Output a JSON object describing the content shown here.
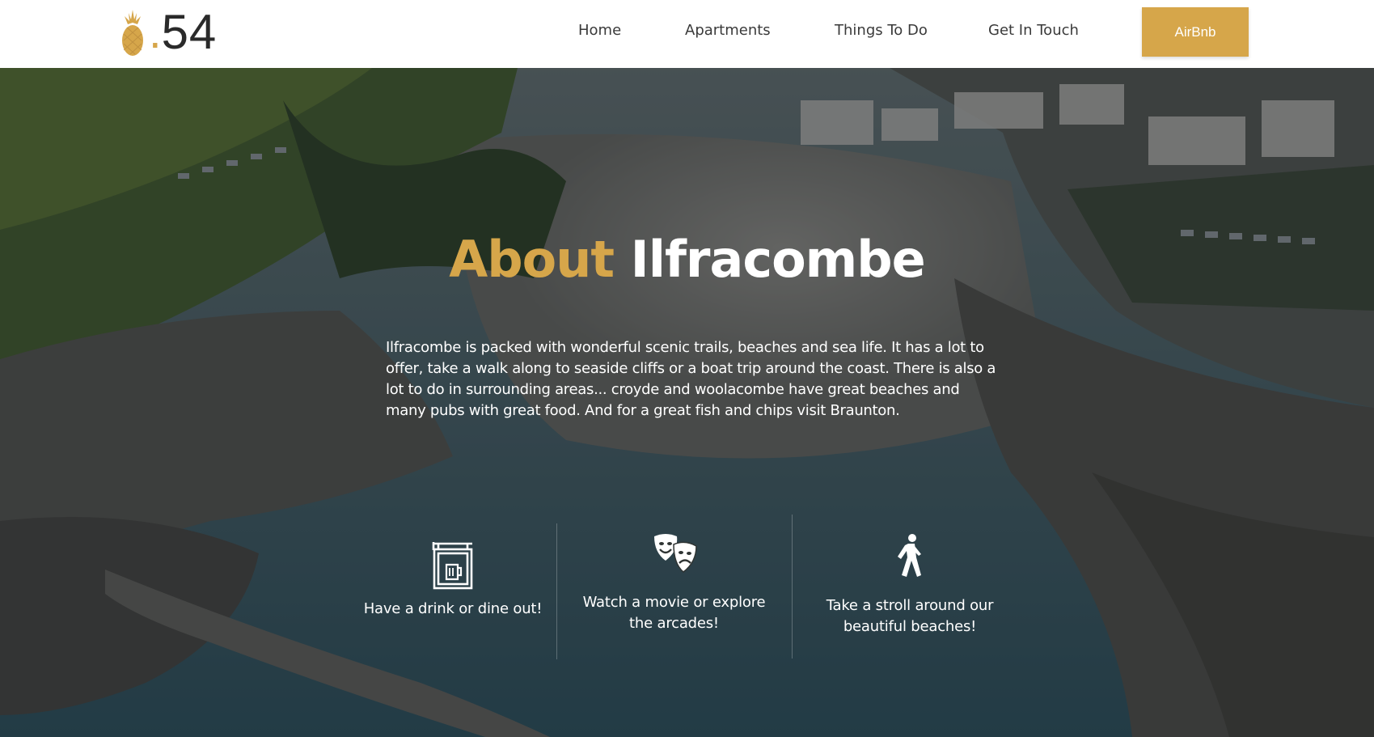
{
  "brand": {
    "logo_dot": ".",
    "logo_number": "54",
    "accent_color": "#d6a64a"
  },
  "nav": {
    "items": [
      {
        "label": "Home"
      },
      {
        "label": "Apartments"
      },
      {
        "label": "Things To Do"
      },
      {
        "label": "Get In Touch"
      }
    ],
    "cta_label": "AirBnb"
  },
  "hero": {
    "title_accent": "About",
    "title_main": "Ilfracombe",
    "description": "Ilfracombe is packed with wonderful scenic trails, beaches and sea life. It has a lot to offer, take a walk along to seaside cliffs or a boat trip around the coast. There is also a lot to do in surrounding areas... croyde and woolacombe have great beaches and many pubs with great food. And for a great fish and chips visit Braunton."
  },
  "features": [
    {
      "icon": "pub-sign-icon",
      "label": "Have a drink or dine out!"
    },
    {
      "icon": "theater-masks-icon",
      "label": "Watch a movie or explore the arcades!"
    },
    {
      "icon": "walking-person-icon",
      "label": "Take a stroll around our beautiful beaches!"
    }
  ]
}
